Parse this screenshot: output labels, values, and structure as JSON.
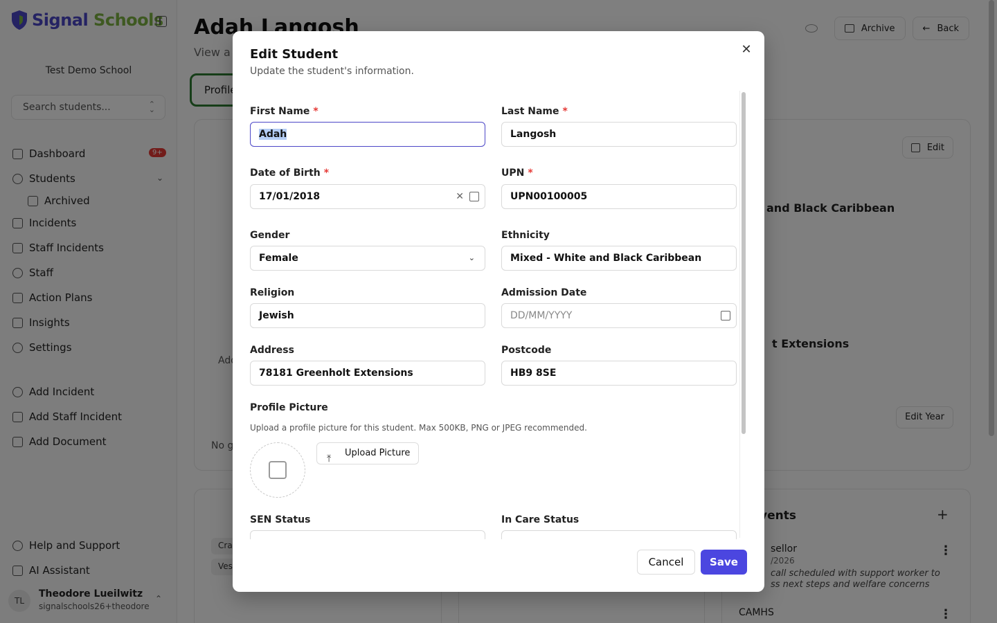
{
  "brand": {
    "name_part1": "Signal",
    "name_part2": " Schools"
  },
  "sidebar": {
    "school": "Test Demo School",
    "search_placeholder": "Search students...",
    "nav": [
      {
        "label": "Dashboard",
        "badge": "9+"
      },
      {
        "label": "Students"
      },
      {
        "label": "Archived"
      },
      {
        "label": "Incidents"
      },
      {
        "label": "Staff Incidents"
      },
      {
        "label": "Staff"
      },
      {
        "label": "Action Plans"
      },
      {
        "label": "Insights"
      },
      {
        "label": "Settings"
      }
    ],
    "quick": [
      {
        "label": "Add Incident"
      },
      {
        "label": "Add Staff Incident"
      },
      {
        "label": "Add Document"
      }
    ],
    "bottom": [
      {
        "label": "Help and Support"
      },
      {
        "label": "AI Assistant"
      }
    ],
    "user": {
      "initials": "TL",
      "name": "Theodore Lueilwitz",
      "email": "signalschools26+theodore"
    }
  },
  "page": {
    "title": "Adah Langosh",
    "subtitle": "View a",
    "archive_label": "Archive",
    "back_label": "Back",
    "tab_profile": "Profile",
    "edit_label": "Edit",
    "edit_year_label": "Edit Year",
    "bg_ethnicity_fragment": "and Black Caribbean",
    "bg_address_fragment": "t Extensions",
    "bg_add_fragment": "Add",
    "bg_nog_fragment": "No g",
    "bg_events_fragment": "vents",
    "events": [
      {
        "title": "sellor",
        "date": "/2026",
        "desc": "call scheduled with support worker to ss next steps and welfare concerns"
      },
      {
        "title": "CAMHS",
        "date": "",
        "desc": ""
      }
    ],
    "pill_1": "Cra",
    "pill_2": "Ves"
  },
  "modal": {
    "title": "Edit Student",
    "subtitle": "Update the student's information.",
    "first_name_label": "First Name",
    "first_name_value": "Adah",
    "last_name_label": "Last Name",
    "last_name_value": "Langosh",
    "dob_label": "Date of Birth",
    "dob_value": "17/01/2018",
    "upn_label": "UPN",
    "upn_value": "UPN00100005",
    "gender_label": "Gender",
    "gender_value": "Female",
    "ethnicity_label": "Ethnicity",
    "ethnicity_value": "Mixed - White and Black Caribbean",
    "religion_label": "Religion",
    "religion_value": "Jewish",
    "admission_label": "Admission Date",
    "admission_placeholder": "DD/MM/YYYY",
    "address_label": "Address",
    "address_value": "78181 Greenholt Extensions",
    "postcode_label": "Postcode",
    "postcode_value": "HB9 8SE",
    "profile_picture_label": "Profile Picture",
    "profile_picture_help": "Upload a profile picture for this student. Max 500KB, PNG or JPEG recommended.",
    "upload_label": "Upload Picture",
    "sen_label": "SEN Status",
    "in_care_label": "In Care Status",
    "required_mark": "*",
    "cancel_label": "Cancel",
    "save_label": "Save"
  },
  "colors": {
    "accent": "#4b46e0",
    "brand_green": "#7cb342",
    "required": "#e53935"
  }
}
